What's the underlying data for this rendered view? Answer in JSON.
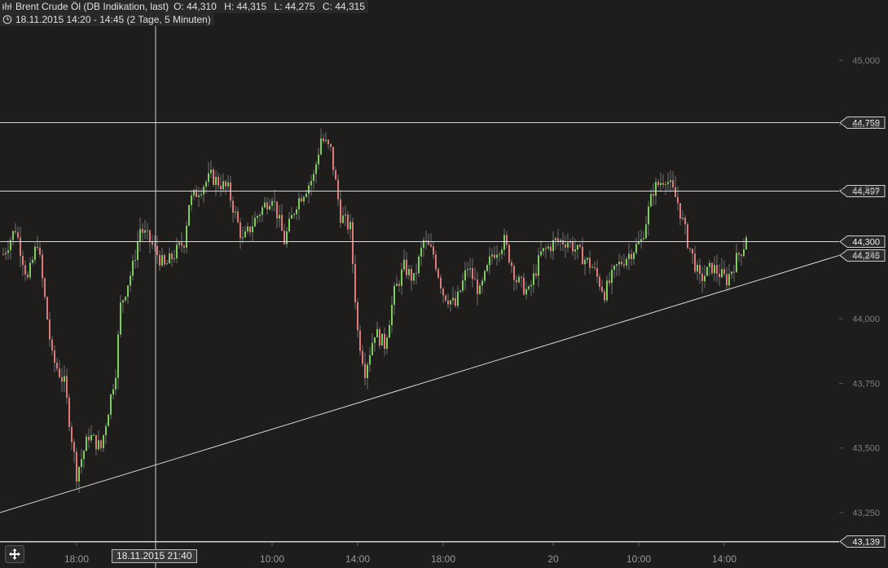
{
  "header": {
    "title": "Brent Crude Öl (DB Indikation, last)",
    "open": "O: 44,310",
    "high": "H: 44,315",
    "low": "L: 44,275",
    "close": "C: 44,315",
    "range": "18.11.2015 14:20 - 14:45 (2 Tage, 5 Minuten)"
  },
  "crosshair_date": "18.11.2015 21:40",
  "colors": {
    "background": "#1f1d1c",
    "up": "#7cd05a",
    "down": "#e07a7a",
    "wick": "#6f6f6f",
    "line": "#d8d8d8"
  },
  "chart_data": {
    "type": "candlestick",
    "title": "Brent Crude Öl (DB Indikation, last)",
    "ylim": [
      43.1,
      45.2
    ],
    "yticks": [
      "45,000",
      "44,750",
      "44,500",
      "44,250",
      "44,000",
      "43,750",
      "43,500",
      "43,250"
    ],
    "ytick_values": [
      45.0,
      44.75,
      44.5,
      44.25,
      44.0,
      43.75,
      43.5,
      43.25
    ],
    "xticks": [
      "18:00",
      "10:00",
      "14:00",
      "18:00",
      "20",
      "10:00",
      "14:00"
    ],
    "xtick_index": [
      30,
      110,
      145,
      180,
      225,
      260,
      295
    ],
    "n_candles": 305,
    "levels": [
      {
        "value": 44.759,
        "label": "44,759"
      },
      {
        "value": 44.497,
        "label": "44,497"
      },
      {
        "value": 44.3,
        "label": "44,300"
      },
      {
        "value": 43.139,
        "label": "43,139"
      }
    ],
    "trendline": {
      "from_index": 0,
      "from_value": 43.25,
      "to_index": 343,
      "to_value": 44.245,
      "label": "44,245"
    },
    "price_path": [
      [
        0,
        44.25
      ],
      [
        5,
        44.35
      ],
      [
        10,
        44.15
      ],
      [
        14,
        44.3
      ],
      [
        20,
        43.85
      ],
      [
        25,
        43.75
      ],
      [
        30,
        43.4
      ],
      [
        35,
        43.55
      ],
      [
        40,
        43.5
      ],
      [
        46,
        43.8
      ],
      [
        48,
        44.05
      ],
      [
        53,
        44.2
      ],
      [
        56,
        44.35
      ],
      [
        60,
        44.3
      ],
      [
        66,
        44.2
      ],
      [
        70,
        44.25
      ],
      [
        74,
        44.3
      ],
      [
        76,
        44.45
      ],
      [
        80,
        44.5
      ],
      [
        85,
        44.55
      ],
      [
        92,
        44.5
      ],
      [
        98,
        44.3
      ],
      [
        104,
        44.4
      ],
      [
        110,
        44.48
      ],
      [
        115,
        44.3
      ],
      [
        120,
        44.45
      ],
      [
        127,
        44.55
      ],
      [
        130,
        44.7
      ],
      [
        134,
        44.65
      ],
      [
        138,
        44.4
      ],
      [
        142,
        44.35
      ],
      [
        145,
        43.95
      ],
      [
        148,
        43.8
      ],
      [
        152,
        43.95
      ],
      [
        156,
        43.9
      ],
      [
        160,
        44.1
      ],
      [
        164,
        44.2
      ],
      [
        168,
        44.15
      ],
      [
        172,
        44.3
      ],
      [
        176,
        44.25
      ],
      [
        180,
        44.1
      ],
      [
        185,
        44.05
      ],
      [
        190,
        44.2
      ],
      [
        195,
        44.1
      ],
      [
        200,
        44.25
      ],
      [
        205,
        44.3
      ],
      [
        210,
        44.15
      ],
      [
        215,
        44.1
      ],
      [
        220,
        44.25
      ],
      [
        226,
        44.3
      ],
      [
        231,
        44.3
      ],
      [
        236,
        44.25
      ],
      [
        241,
        44.2
      ],
      [
        246,
        44.1
      ],
      [
        251,
        44.2
      ],
      [
        256,
        44.25
      ],
      [
        261,
        44.3
      ],
      [
        266,
        44.5
      ],
      [
        271,
        44.55
      ],
      [
        276,
        44.45
      ],
      [
        280,
        44.3
      ],
      [
        285,
        44.15
      ],
      [
        290,
        44.2
      ],
      [
        296,
        44.15
      ],
      [
        301,
        44.25
      ],
      [
        304,
        44.3
      ]
    ],
    "last_close": 44.315
  }
}
